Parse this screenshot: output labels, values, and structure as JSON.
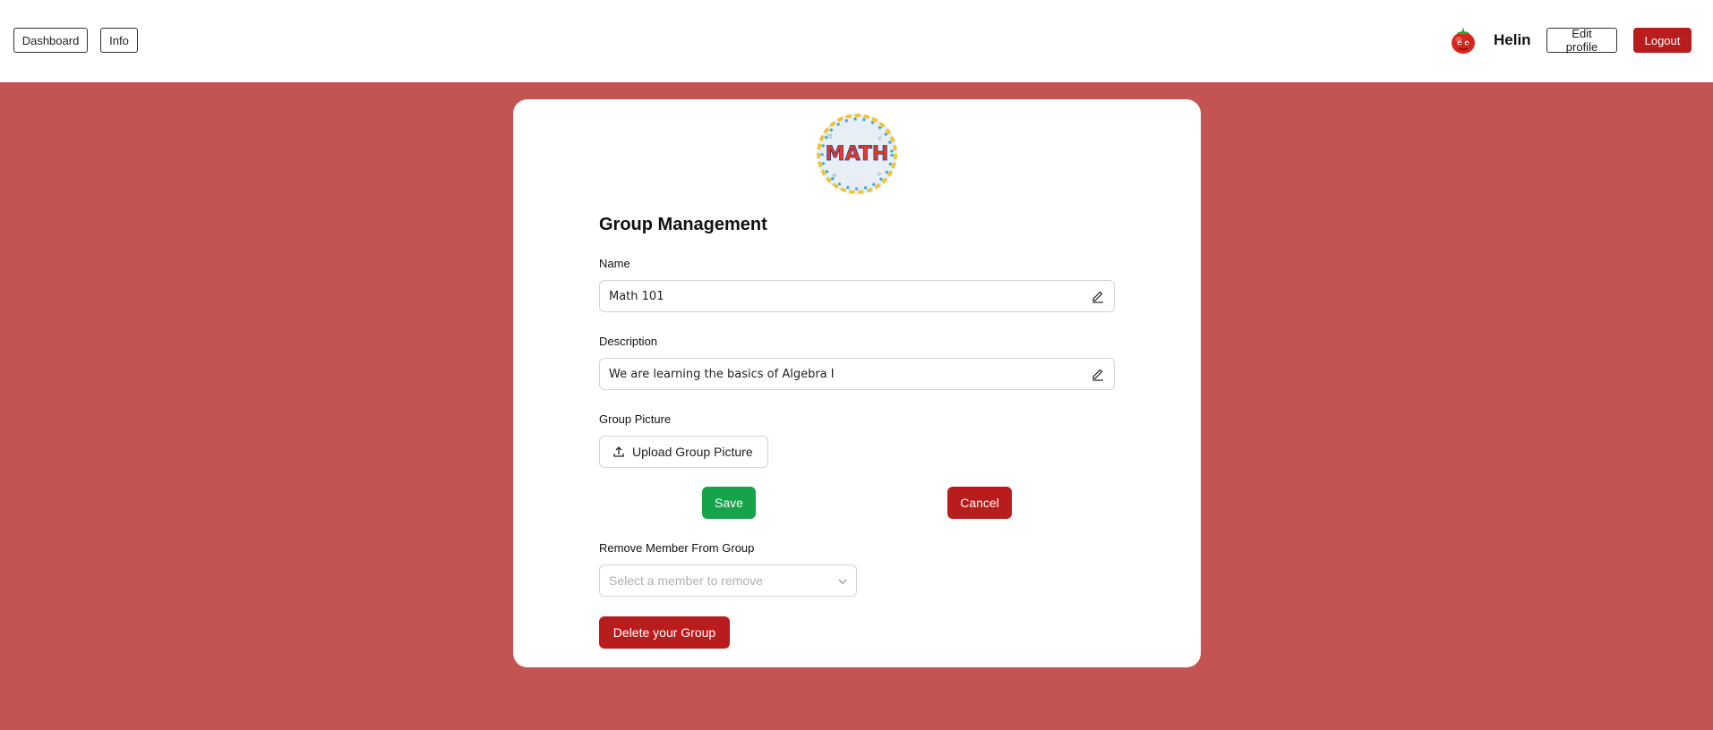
{
  "header": {
    "nav": [
      {
        "label": "Dashboard"
      },
      {
        "label": "Info"
      }
    ],
    "user": {
      "name": "Helin",
      "avatar_icon": "tomato-avatar-icon"
    },
    "edit_profile_label": "Edit profile",
    "logout_label": "Logout"
  },
  "colors": {
    "background": "#c45452",
    "accent_red": "#b91c1c",
    "save_green": "#16a34a"
  },
  "group": {
    "picture_icon": "math-group-picture",
    "picture_text": "MATH",
    "title": "Group Management",
    "name_label": "Name",
    "name_value": "Math 101",
    "description_label": "Description",
    "description_value": "We are learning the basics of Algebra I",
    "picture_label": "Group Picture",
    "upload_label": "Upload Group Picture",
    "save_label": "Save",
    "cancel_label": "Cancel",
    "remove_label": "Remove Member From Group",
    "remove_placeholder": "Select a member to remove",
    "delete_label": "Delete your Group"
  }
}
